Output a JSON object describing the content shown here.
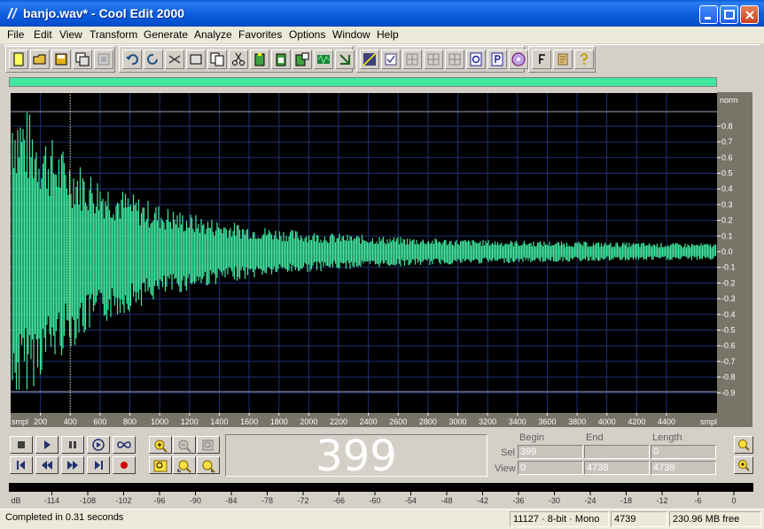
{
  "window": {
    "title": "banjo.wav* - Cool Edit 2000"
  },
  "menu": [
    "File",
    "Edit",
    "View",
    "Transform",
    "Generate",
    "Analyze",
    "Favorites",
    "Options",
    "Window",
    "Help"
  ],
  "waveform": {
    "channel_label": "norm",
    "y_ticks": [
      "0.8",
      "0.7",
      "0.6",
      "0.5",
      "0.4",
      "0.3",
      "0.2",
      "0.1",
      "0.0",
      "-0.1",
      "-0.2",
      "-0.3",
      "-0.4",
      "-0.5",
      "-0.6",
      "-0.7",
      "-0.8",
      "-0.9"
    ],
    "x_unit_left": "smpl",
    "x_unit_right": "smpl",
    "x_ticks": [
      "200",
      "400",
      "600",
      "800",
      "1000",
      "1200",
      "1400",
      "1600",
      "1800",
      "2000",
      "2200",
      "2400",
      "2600",
      "2800",
      "3000",
      "3200",
      "3400",
      "3600",
      "3800",
      "4000",
      "4200",
      "4400"
    ],
    "cursor_sample": 399,
    "total_samples": 4739
  },
  "colors": {
    "wave": "#40e8a0",
    "background": "#000000",
    "grid": "#203070",
    "cursor": "#ffff40"
  },
  "transport": {
    "buttons": [
      "stop-icon",
      "play-icon",
      "pause-icon",
      "play-to-end-icon",
      "loop-icon",
      "go-to-start-icon",
      "rewind-icon",
      "fast-forward-icon",
      "go-to-end-icon",
      "record-icon"
    ],
    "zoom": [
      "zoom-in-icon",
      "zoom-out-icon",
      "zoom-full-icon",
      "zoom-selection-icon",
      "zoom-left-icon",
      "zoom-right-icon"
    ]
  },
  "time_display": "399",
  "selection": {
    "headers": {
      "begin": "Begin",
      "end": "End",
      "length": "Length"
    },
    "sel_label": "Sel",
    "view_label": "View",
    "sel": {
      "begin": "399",
      "end": "",
      "length": "0"
    },
    "view": {
      "begin": "0",
      "end": "4738",
      "length": "4739"
    }
  },
  "meter": {
    "ticks": [
      "dB",
      "-114",
      "-108",
      "-102",
      "-96",
      "-90",
      "-84",
      "-78",
      "-72",
      "-66",
      "-60",
      "-54",
      "-48",
      "-42",
      "-36",
      "-30",
      "-24",
      "-18",
      "-12",
      "-6",
      "0"
    ]
  },
  "status": {
    "message": "Completed in 0.31 seconds",
    "format": "11127 · 8-bit · Mono",
    "samples": "4739",
    "free": "230.96 MB free"
  }
}
